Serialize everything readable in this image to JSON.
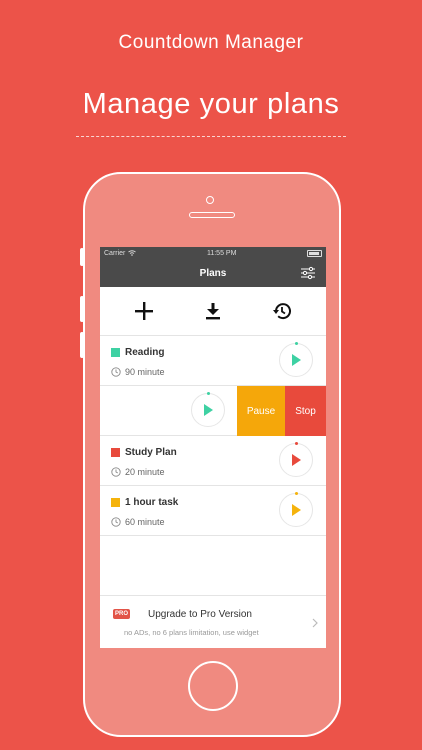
{
  "header": {
    "app_name": "Countdown Manager",
    "tagline": "Manage your plans"
  },
  "status_bar": {
    "carrier": "Carrier",
    "time": "11:55 PM"
  },
  "nav": {
    "title": "Plans",
    "settings_icon": "sliders-icon"
  },
  "toolbar": {
    "items": [
      {
        "icon": "plus-icon"
      },
      {
        "icon": "download-icon"
      },
      {
        "icon": "history-icon"
      }
    ]
  },
  "plans": [
    {
      "name": "Reading",
      "duration": "90 minute",
      "color": "#3ed1a3",
      "play_color": "#3ed1a3"
    },
    {
      "name": "",
      "duration": "",
      "color": "#3ed1a3",
      "play_color": "#3ed1a3",
      "swiped": true
    },
    {
      "name": "Study Plan",
      "duration": "20 minute",
      "color": "#e84a3c",
      "play_color": "#e84a3c"
    },
    {
      "name": "1 hour task",
      "duration": "60 minute",
      "color": "#f5b30c",
      "play_color": "#f5b30c"
    }
  ],
  "swipe_actions": {
    "pause_label": "Pause",
    "pause_color": "#f5a70a",
    "stop_label": "Stop",
    "stop_color": "#e84a3c"
  },
  "promo": {
    "badge": "PRO",
    "title": "Upgrade to Pro Version",
    "subtitle": "no ADs, no 6 plans limitation, use widget"
  },
  "colors": {
    "background": "#ec5349",
    "phone_body": "#f08a80",
    "nav_bar": "#4a4a4a"
  }
}
